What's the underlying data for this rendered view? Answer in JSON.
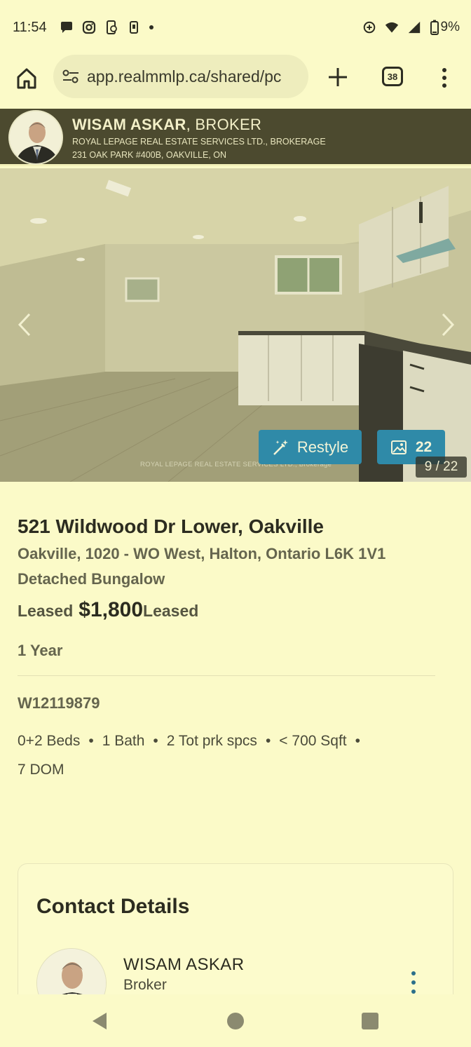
{
  "status_bar": {
    "time": "11:54",
    "battery": "9%",
    "icons": [
      "chat-icon",
      "instagram-icon",
      "phone-sync-icon",
      "device-icon",
      "notification-dot",
      "data-saver-icon",
      "wifi-icon",
      "signal-icon",
      "battery-icon"
    ]
  },
  "browser": {
    "url": "app.realmmlp.ca/shared/pc",
    "tab_count": "38"
  },
  "agent_banner": {
    "name": "WISAM ASKAR",
    "title": ", BROKER",
    "brokerage": "ROYAL LEPAGE REAL ESTATE SERVICES LTD., BROKERAGE",
    "address": "231 OAK PARK #400B, OAKVILLE, ON"
  },
  "gallery": {
    "restyle_label": "Restyle",
    "photo_count": "22",
    "counter": "9 / 22",
    "watermark": "ROYAL LEPAGE REAL ESTATE SERVICES LTD., Brokerage"
  },
  "listing": {
    "address": "521 Wildwood Dr Lower, Oakville",
    "area": "Oakville, 1020 - WO West, Halton, Ontario L6K 1V1",
    "type": "Detached Bungalow",
    "status_before": "Leased",
    "price": "$1,800",
    "status_after": "Leased",
    "term": "1 Year",
    "mls": "W12119879",
    "beds": "0+2 Beds",
    "baths": "1 Bath",
    "parking": "2 Tot prk spcs",
    "sqft": "< 700 Sqft",
    "dom": "7 DOM",
    "separator": "•"
  },
  "contact": {
    "heading": "Contact Details",
    "name": "WISAM ASKAR",
    "role": "Broker"
  },
  "colors": {
    "page_bg": "#fbfac8",
    "banner_bg": "#4c4a2f",
    "accent_button": "#2f8aa8",
    "text_primary": "#2c2c20",
    "text_secondary": "#65654e"
  }
}
